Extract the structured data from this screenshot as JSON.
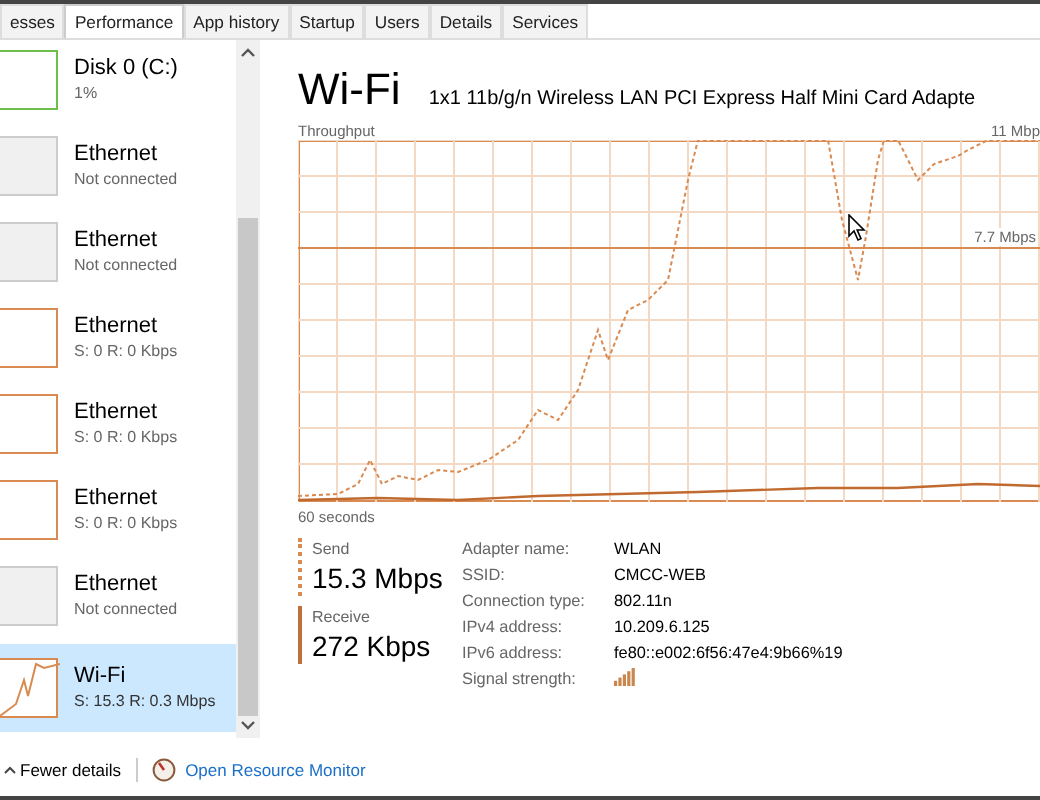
{
  "tabs": [
    {
      "label": "esses",
      "selected": false
    },
    {
      "label": "Performance",
      "selected": true
    },
    {
      "label": "App history",
      "selected": false
    },
    {
      "label": "Startup",
      "selected": false
    },
    {
      "label": "Users",
      "selected": false
    },
    {
      "label": "Details",
      "selected": false
    },
    {
      "label": "Services",
      "selected": false
    }
  ],
  "sidebar": {
    "items": [
      {
        "kind": "disk",
        "name": "Disk 0 (C:)",
        "detail": "1%",
        "connected": true,
        "selected": false
      },
      {
        "kind": "network",
        "name": "Ethernet",
        "detail": "Not connected",
        "connected": false,
        "selected": false
      },
      {
        "kind": "network",
        "name": "Ethernet",
        "detail": "Not connected",
        "connected": false,
        "selected": false
      },
      {
        "kind": "network",
        "name": "Ethernet",
        "detail": "S: 0 R: 0 Kbps",
        "connected": true,
        "selected": false
      },
      {
        "kind": "network",
        "name": "Ethernet",
        "detail": "S: 0 R: 0 Kbps",
        "connected": true,
        "selected": false
      },
      {
        "kind": "network",
        "name": "Ethernet",
        "detail": "S: 0 R: 0 Kbps",
        "connected": true,
        "selected": false
      },
      {
        "kind": "network",
        "name": "Ethernet",
        "detail": "Not connected",
        "connected": false,
        "selected": false
      },
      {
        "kind": "network",
        "name": "Wi-Fi",
        "detail": "S: 15.3 R: 0.3 Mbps",
        "connected": true,
        "selected": true
      }
    ]
  },
  "detail": {
    "title": "Wi-Fi",
    "adapter": "1x1 11b/g/n Wireless LAN PCI Express Half Mini Card Adapte",
    "graph": {
      "label": "Throughput",
      "max_label": "11 Mbp",
      "mid_label": "7.7 Mbps",
      "time_label": "60 seconds"
    },
    "send": {
      "label": "Send",
      "value": "15.3 Mbps"
    },
    "receive": {
      "label": "Receive",
      "value": "272 Kbps"
    },
    "properties": [
      {
        "label": "Adapter name:",
        "value": "WLAN"
      },
      {
        "label": "SSID:",
        "value": "CMCC-WEB"
      },
      {
        "label": "Connection type:",
        "value": "802.11n"
      },
      {
        "label": "IPv4 address:",
        "value": "10.209.6.125"
      },
      {
        "label": "IPv6 address:",
        "value": "fe80::e002:6f56:47e4:9b66%19"
      },
      {
        "label": "Signal strength:",
        "kind": "signal"
      }
    ]
  },
  "footer": {
    "fewer_details": "Fewer details",
    "resource_monitor": "Open Resource Monitor"
  }
}
